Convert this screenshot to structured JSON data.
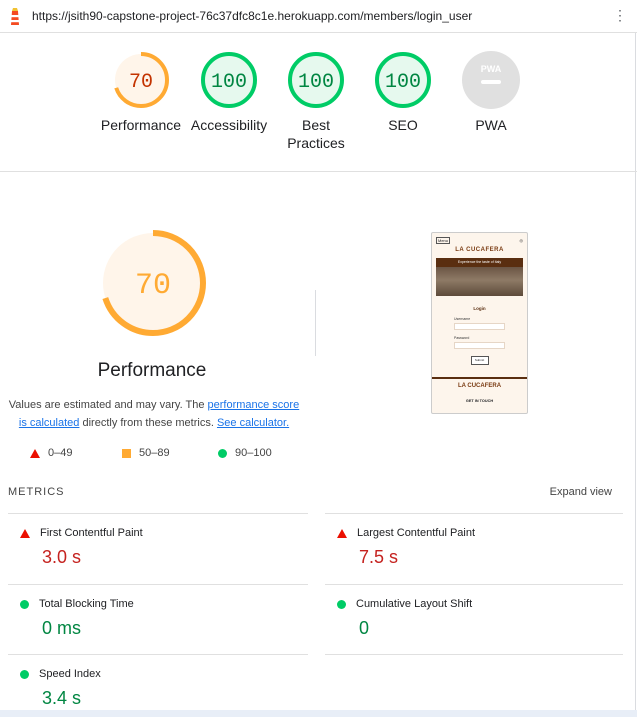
{
  "url": "https://jsith90-capstone-project-76c37dfc8c1e.herokuapp.com/members/login_user",
  "summary": [
    {
      "score": "70",
      "label": "Performance",
      "status": "average",
      "fraction": 0.7
    },
    {
      "score": "100",
      "label": "Accessibility",
      "status": "pass",
      "fraction": 1.0
    },
    {
      "score": "100",
      "label": "Best Practices",
      "status": "pass",
      "fraction": 1.0
    },
    {
      "score": "100",
      "label": "SEO",
      "status": "pass",
      "fraction": 1.0
    },
    {
      "score": "PWA",
      "label": "PWA",
      "status": "na",
      "fraction": 0
    }
  ],
  "performance": {
    "score": "70",
    "title": "Performance",
    "desc_1": "Values are estimated and may vary. The ",
    "link_1": "performance score is calculated",
    "desc_2": " directly from these metrics. ",
    "link_2": "See calculator."
  },
  "legend": [
    {
      "range": "0–49",
      "shape": "triangle",
      "color": "#eb0f00"
    },
    {
      "range": "50–89",
      "shape": "square",
      "color": "#ffaa33"
    },
    {
      "range": "90–100",
      "shape": "circle",
      "color": "#00cc66"
    }
  ],
  "preview": {
    "brand": "LA CUCAFERA",
    "hero_text": "Experience the taste of Italy",
    "login": "Login",
    "username_label": "Username",
    "password_label": "Password",
    "submit": "Submit",
    "footer_brand": "LA CUCAFERA",
    "get_in_touch": "GET IN TOUCH"
  },
  "metrics": {
    "header": "METRICS",
    "expand": "Expand view",
    "items": [
      {
        "name": "First Contentful Paint",
        "value": "3.0 s",
        "status": "fail"
      },
      {
        "name": "Largest Contentful Paint",
        "value": "7.5 s",
        "status": "fail"
      },
      {
        "name": "Total Blocking Time",
        "value": "0 ms",
        "status": "pass"
      },
      {
        "name": "Cumulative Layout Shift",
        "value": "0",
        "status": "pass"
      },
      {
        "name": "Speed Index",
        "value": "3.4 s",
        "status": "pass"
      }
    ]
  },
  "colors": {
    "pass": "#0c6",
    "average": "#fa3",
    "fail": "#eb0f00",
    "na": "#9e9e9e"
  }
}
